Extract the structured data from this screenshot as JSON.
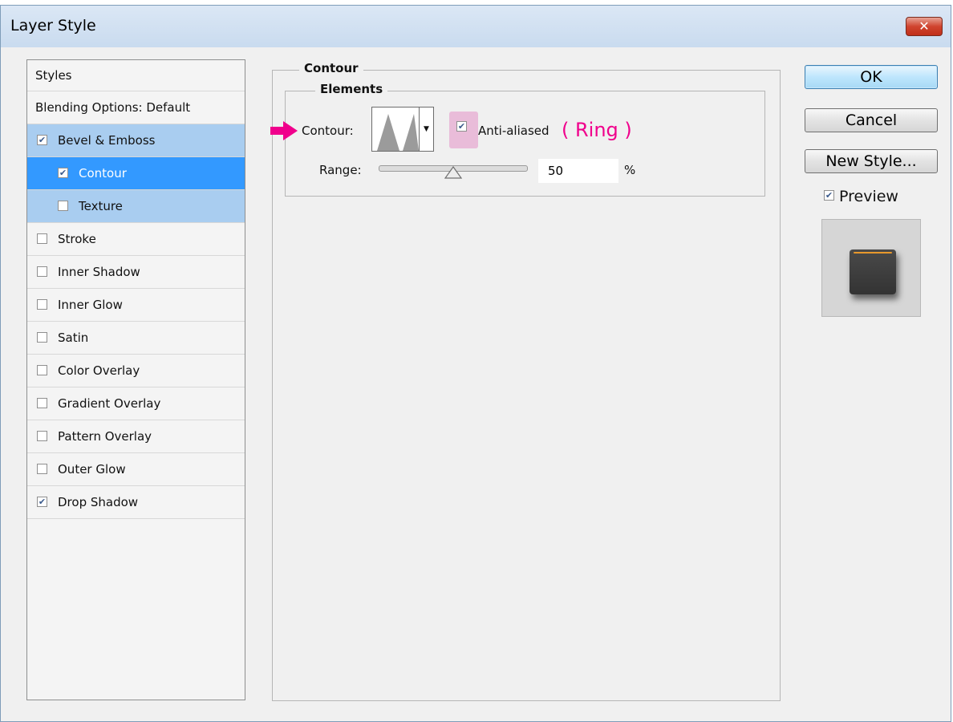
{
  "window": {
    "title": "Layer Style",
    "close_glyph": "✕"
  },
  "styles_panel": {
    "header": "Styles",
    "items": [
      {
        "label": "Blending Options: Default",
        "checked": null
      },
      {
        "label": "Bevel & Emboss",
        "checked": true
      },
      {
        "label": "Contour",
        "checked": true
      },
      {
        "label": "Texture",
        "checked": false
      },
      {
        "label": "Stroke",
        "checked": false
      },
      {
        "label": "Inner Shadow",
        "checked": false
      },
      {
        "label": "Inner Glow",
        "checked": false
      },
      {
        "label": "Satin",
        "checked": false
      },
      {
        "label": "Color Overlay",
        "checked": false
      },
      {
        "label": "Gradient Overlay",
        "checked": false
      },
      {
        "label": "Pattern Overlay",
        "checked": false
      },
      {
        "label": "Outer Glow",
        "checked": false
      },
      {
        "label": "Drop Shadow",
        "checked": true
      }
    ],
    "selected": "Contour"
  },
  "contour_section": {
    "legend": "Contour",
    "elements_legend": "Elements",
    "contour_label": "Contour:",
    "anti_aliased_label": "Anti-aliased",
    "anti_aliased_checked": true,
    "range_label": "Range:",
    "range_value": "50",
    "range_unit": "%",
    "range_fraction": 0.5
  },
  "annotation": {
    "note": "( Ring )",
    "color": "#f0008c"
  },
  "buttons": {
    "ok": "OK",
    "cancel": "Cancel",
    "new_style": "New Style..."
  },
  "preview": {
    "label": "Preview",
    "checked": true
  },
  "icons": {
    "checkbox_checked": "✔",
    "arrow": "arrow-right-icon"
  },
  "colors": {
    "selected_row": "#3399ff",
    "group_row": "#a9cdf0",
    "swatch_accent": "#e8982c"
  }
}
